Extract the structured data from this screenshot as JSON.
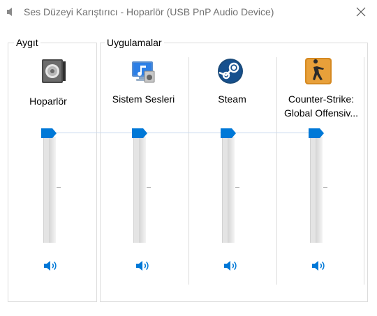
{
  "window": {
    "title": "Ses Düzeyi Karıştırıcı - Hoparlör (USB PnP Audio Device)"
  },
  "device_group": {
    "label": "Aygıt"
  },
  "apps_group": {
    "label": "Uygulamalar"
  },
  "channels": [
    {
      "label": "Hoparlör",
      "icon": "speaker-device-icon",
      "volume": 1.0,
      "muted": false
    },
    {
      "label": "Sistem Sesleri",
      "icon": "system-sounds-icon",
      "volume": 1.0,
      "muted": false
    },
    {
      "label": "Steam",
      "icon": "steam-icon",
      "volume": 1.0,
      "muted": false
    },
    {
      "label_line1": "Counter-Strike:",
      "label_line2": "Global Offensiv...",
      "icon": "counter-strike-icon",
      "volume": 1.0,
      "muted": false
    }
  ],
  "colors": {
    "accent": "#0078d7",
    "track": "#e4e4e4",
    "border": "#dcdcdc"
  }
}
